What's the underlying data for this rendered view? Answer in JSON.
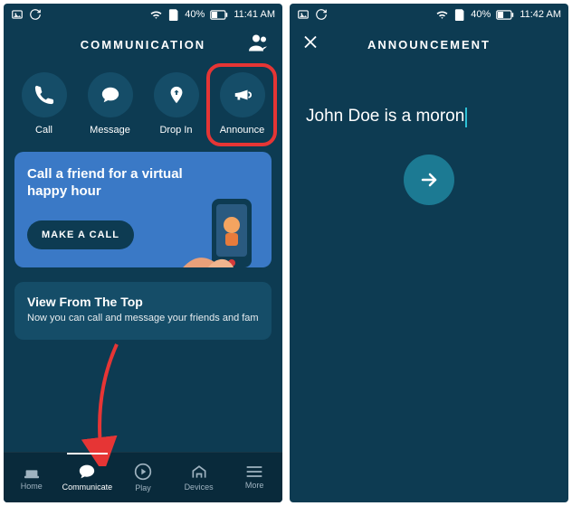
{
  "status": {
    "left_icons": [
      "image-icon",
      "sync-icon"
    ],
    "battery_pct": "40%",
    "time_left": "11:41 AM",
    "time_right": "11:42 AM"
  },
  "left": {
    "header_title": "COMMUNICATION",
    "actions": [
      {
        "label": "Call",
        "icon": "phone-icon"
      },
      {
        "label": "Message",
        "icon": "speech-icon"
      },
      {
        "label": "Drop In",
        "icon": "dropin-icon"
      },
      {
        "label": "Announce",
        "icon": "megaphone-icon"
      }
    ],
    "promo": {
      "title": "Call a friend for a virtual happy hour",
      "button": "MAKE A CALL"
    },
    "info": {
      "title": "View From The Top",
      "subtitle": "Now you can call and message your friends and family tha"
    },
    "nav": [
      {
        "label": "Home",
        "icon": "home-icon"
      },
      {
        "label": "Communicate",
        "icon": "speech-icon"
      },
      {
        "label": "Play",
        "icon": "play-icon"
      },
      {
        "label": "Devices",
        "icon": "devices-icon"
      },
      {
        "label": "More",
        "icon": "menu-icon"
      }
    ],
    "nav_active_index": 1
  },
  "right": {
    "header_title": "ANNOUNCEMENT",
    "input_text": "John Doe is a moron"
  }
}
